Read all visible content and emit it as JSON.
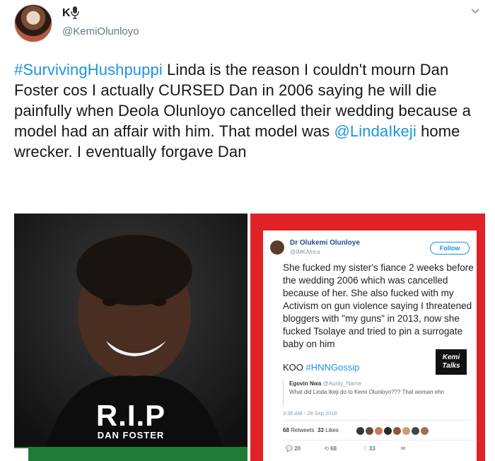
{
  "tweet": {
    "display_name": "K",
    "handle": "@KemiOlunloyo",
    "text": {
      "hashtag": "#SurvivingHushpuppi",
      "part1": " Linda is the reason I couldn't mourn Dan Foster cos I actually CURSED Dan in 2006 saying he will die painfully when Deola Olunloyo cancelled their wedding because a model had an affair with him. That model was ",
      "mention": "@LindaIkeji",
      "part2": " home wrecker. I eventually forgave Dan"
    },
    "icons": [
      "microphone-icon",
      "chevron-down-icon"
    ]
  },
  "media_left": {
    "title": "R.I.P",
    "subtitle": "DAN FOSTER"
  },
  "media_right": {
    "inner_tweet": {
      "name": "Dr Olukemi Olunloye",
      "handle": "@IMKAfrica",
      "follow_label": "Follow",
      "text": "She fucked my sister's fiance 2 weeks before the wedding 2006 which was cancelled because of her. She also fucked with my Activism on gun violence saying I threatened bloggers with \"my guns\" in 2013, now she fucked Tsolaye and tried to pin a surrogate baby on him",
      "tag_prefix": "KOO ",
      "tag": "#HNNGossip",
      "logo_text": "Kemi Talks",
      "quote_name": "Egovin Nwa",
      "quote_handle": "@Aunty_Name",
      "quote_text": "What did Linda Ikeji do to Kemi Olunloyo??? That woman ehn",
      "time": "3:35 AM - 28 Sep 2018",
      "retweets_count": "68",
      "retweets_label": "Retweets",
      "likes_count": "33",
      "likes_label": "Likes",
      "replies": "20",
      "retweets_action": "68",
      "likes_action": "33"
    }
  },
  "colors": {
    "link": "#1b95e0",
    "red_frame": "#e02226",
    "green_strip": "#1f7a36"
  }
}
